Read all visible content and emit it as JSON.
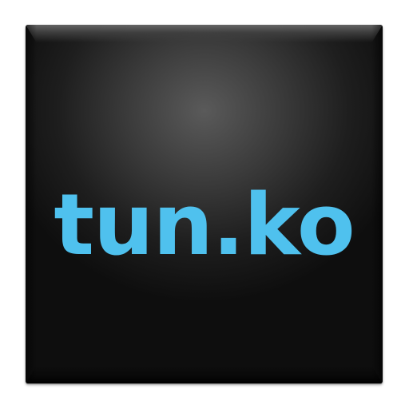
{
  "app_icon": {
    "logo_text": "tun.ko",
    "text_color": "#4fc1ee",
    "tile_color": "#1e1e1e"
  }
}
